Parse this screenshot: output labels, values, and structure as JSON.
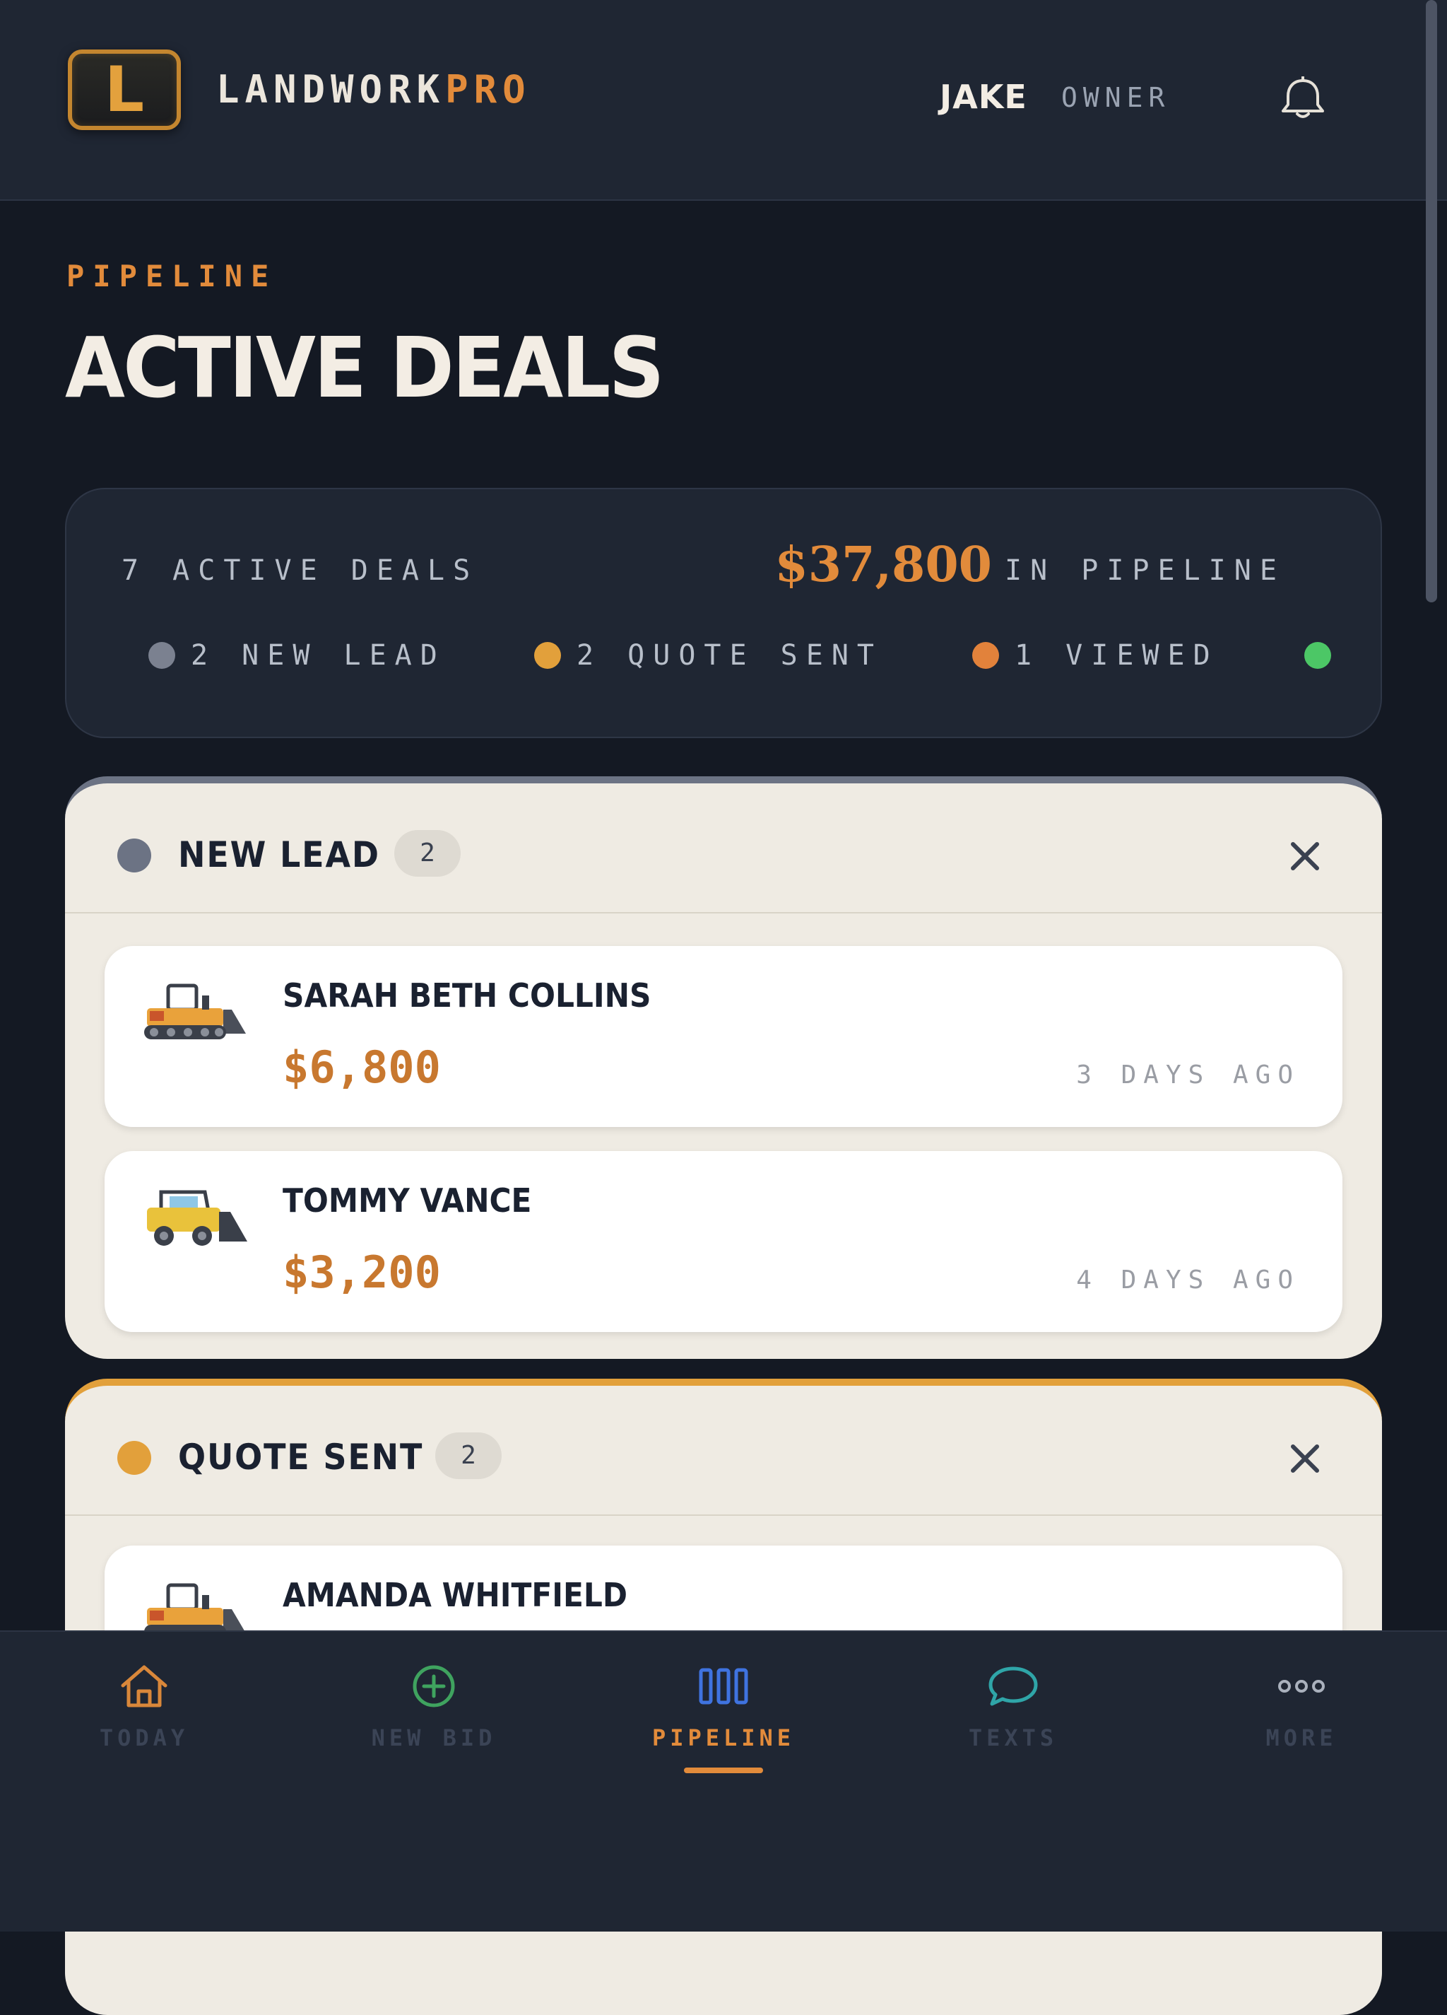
{
  "app": {
    "brand_main": "LANDWORK",
    "brand_accent": "PRO",
    "logo_letter": "L"
  },
  "header": {
    "user_name": "JAKE",
    "user_role": "OWNER",
    "icons": {
      "notifications": "bell-icon"
    }
  },
  "page": {
    "eyebrow": "PIPELINE",
    "title": "ACTIVE DEALS"
  },
  "summary": {
    "active_count_text": "7 ACTIVE DEALS",
    "pipeline_amount": "$37,800",
    "pipeline_suffix": "IN PIPELINE",
    "legend": [
      {
        "label": "2 NEW LEAD",
        "color": "#7b8190"
      },
      {
        "label": "2 QUOTE SENT",
        "color": "#e2a03b"
      },
      {
        "label": "1 VIEWED",
        "color": "#e2823b"
      },
      {
        "label": "",
        "color": "#4cc766"
      }
    ]
  },
  "stages": [
    {
      "name": "NEW LEAD",
      "count": "2",
      "color": "#6c7384",
      "deals": [
        {
          "name": "SARAH BETH COLLINS",
          "amount": "$6,800",
          "age": "3 DAYS AGO",
          "icon": "bulldozer-icon"
        },
        {
          "name": "TOMMY VANCE",
          "amount": "$3,200",
          "age": "4 DAYS AGO",
          "icon": "skid-steer-icon"
        }
      ]
    },
    {
      "name": "QUOTE SENT",
      "count": "2",
      "color": "#e2a03b",
      "deals": [
        {
          "name": "AMANDA WHITFIELD",
          "icon": "bulldozer-icon"
        }
      ]
    }
  ],
  "nav": {
    "items": [
      {
        "label": "TODAY",
        "icon": "home-icon",
        "color": "#d9873a"
      },
      {
        "label": "NEW BID",
        "icon": "plus-circle-icon",
        "color": "#3fa35f"
      },
      {
        "label": "PIPELINE",
        "icon": "columns-icon",
        "color": "#3f73e0",
        "active": true
      },
      {
        "label": "TEXTS",
        "icon": "chat-bubble-icon",
        "color": "#2fa5a8"
      },
      {
        "label": "MORE",
        "icon": "more-dots-icon",
        "color": "#aab1bd"
      }
    ]
  }
}
